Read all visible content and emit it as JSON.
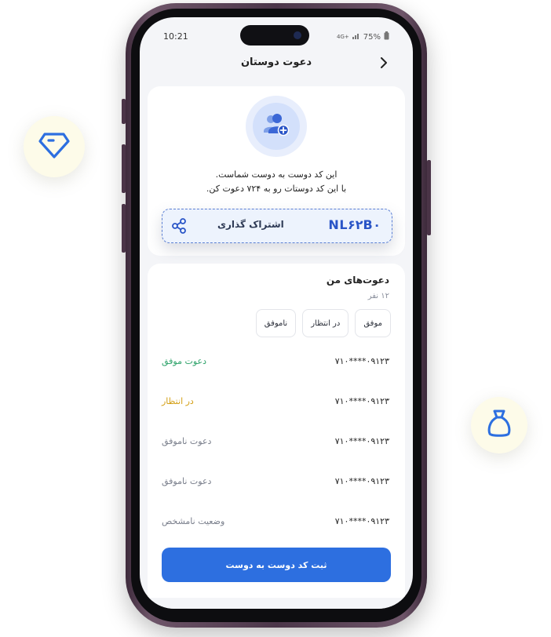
{
  "status_bar": {
    "time": "10:21",
    "network": "4G+",
    "battery": "75%"
  },
  "header": {
    "title": "دعوت دوستان"
  },
  "invite": {
    "line1": "این کد دوست به دوست شماست.",
    "line2": "با این کد دوستات رو به ۷۲۴ دعوت کن.",
    "code": "NL۶۲B۰",
    "share_label": "اشتراک گذاری"
  },
  "my_invites": {
    "title": "دعوت‌های من",
    "count": "۱۲ نفر",
    "filters": [
      "موفق",
      "در انتظار",
      "ناموفق"
    ],
    "rows": [
      {
        "phone": "۰۹۱۲۳****۷۱۰",
        "status": "دعوت موفق",
        "color": "#2fa36b"
      },
      {
        "phone": "۰۹۱۲۳****۷۱۰",
        "status": "در انتظار",
        "color": "#d4a017"
      },
      {
        "phone": "۰۹۱۲۳****۷۱۰",
        "status": "دعوت ناموفق",
        "color": "#7a7f8c"
      },
      {
        "phone": "۰۹۱۲۳****۷۱۰",
        "status": "دعوت ناموفق",
        "color": "#7a7f8c"
      },
      {
        "phone": "۰۹۱۲۳****۷۱۰",
        "status": "وضعیت نامشخص",
        "color": "#7a7f8c"
      }
    ]
  },
  "submit": {
    "label": "ثبت کد دوست به دوست"
  },
  "colors": {
    "primary": "#2d6fe0",
    "code_text": "#2a55c7",
    "badge_bg": "#fdfbe9"
  }
}
